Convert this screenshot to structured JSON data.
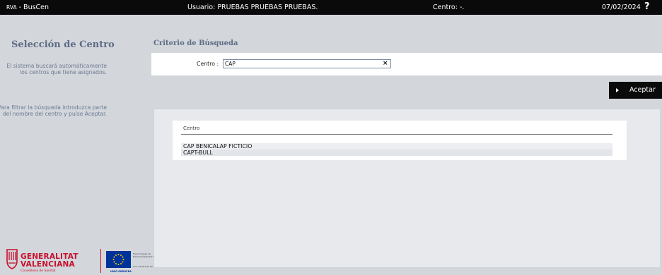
{
  "topbar": {
    "app_prefix": "RVA",
    "app_name": " - BusCen",
    "user": "Usuario: PRUEBAS PRUEBAS PRUEBAS.",
    "centro": "Centro: -.",
    "date": "07/02/2024",
    "help": "?"
  },
  "sidebar": {
    "title": "Selección de Centro",
    "text1": "El sistema buscará automáticamente los centros que tiene asignados.",
    "text2": "Para filtrar la búsqueda introduzca parte del nombre del centro y pulse Aceptar."
  },
  "logos": {
    "gva_line1": "GENERALITAT",
    "gva_line2": "VALENCIANA",
    "gva_line3": "Conselleria de Sanitat",
    "eu_text_a": "Fons Europeu de",
    "eu_text_b": "Desenvolupament Regional",
    "eu_text_c": "Una manera de fer Europa",
    "eu_label": "UNIÓ EUROPEA"
  },
  "search": {
    "title": "Criterio de Búsqueda",
    "label": "Centro :",
    "value": "CAP",
    "clear": "×"
  },
  "actions": {
    "accept_label": "Aceptar"
  },
  "results": {
    "column_header": "Centro",
    "rows": [
      "CAP BENICALAP FICTICIO",
      "CAPT-BULL"
    ]
  },
  "colors": {
    "topbar": "#0a0a0a",
    "background": "#d3d6db",
    "heading": "#5e6c85",
    "brand_red": "#c8102e",
    "eu_blue": "#003399"
  }
}
